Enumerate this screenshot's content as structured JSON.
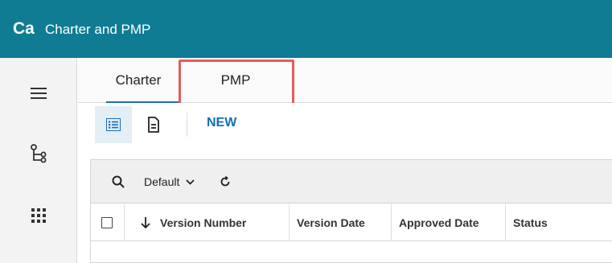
{
  "header": {
    "app_code": "Ca",
    "title": "Charter and PMP"
  },
  "leftrail": {
    "icons": [
      "hamburger-menu-icon",
      "tree-hierarchy-icon",
      "app-grid-icon"
    ]
  },
  "tabs": [
    {
      "label": "Charter",
      "active": true
    },
    {
      "label": "PMP",
      "active": false,
      "highlighted": true
    }
  ],
  "toolbar": {
    "list_view_icon": "list-view-icon",
    "document_icon": "document-icon",
    "new_label": "NEW"
  },
  "filterbar": {
    "search_icon": "search-icon",
    "view_label": "Default",
    "view_icon": "chevron-down-icon",
    "refresh_icon": "refresh-icon"
  },
  "table": {
    "columns": [
      "Version Number",
      "Version Date",
      "Approved Date",
      "Status"
    ],
    "sort_icon": "sort-down-arrow-icon"
  },
  "colors": {
    "header_bg": "#0f7c93",
    "accent": "#0f6fb3",
    "highlight_border": "#e55b5b"
  }
}
